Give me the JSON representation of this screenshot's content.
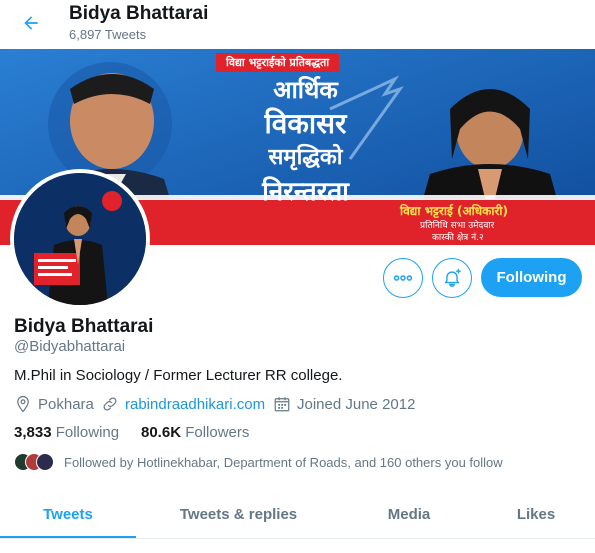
{
  "header": {
    "title": "Bidya Bhattarai",
    "tweet_count": "6,897 Tweets",
    "back_icon": "arrow-left-icon"
  },
  "banner": {
    "tag": "विद्या भट्टराईको प्रतिबद्धता",
    "title_line1": "आर्थिक",
    "title_line2": "विकासर",
    "title_line3": "समृद्धिको",
    "title_line4": "निरन्तरता",
    "candidate_name": "विद्या भट्टराई (अधिकारी)",
    "subtitle1": "प्रतिनिधि सभा उमेदवार",
    "subtitle2": "कास्की क्षेत्र नं.२",
    "colors": {
      "blue": "#1a5fb4",
      "red": "#e0222a",
      "yellow": "#ffe34d"
    }
  },
  "actions": {
    "more_icon": "more-icon",
    "notify_icon": "bell-plus-icon",
    "follow_label": "Following"
  },
  "profile": {
    "name": "Bidya Bhattarai",
    "handle": "@Bidyabhattarai",
    "bio": "M.Phil in Sociology / Former Lecturer RR college.",
    "location": "Pokhara",
    "website": "rabindraadhikari.com",
    "joined": "Joined June 2012",
    "following_count": "3,833",
    "following_label": "Following",
    "followers_count": "80.6K",
    "followers_label": "Followers",
    "followed_by": "Followed by Hotlinekhabar, Department of Roads, and 160 others you follow"
  },
  "tabs": [
    {
      "label": "Tweets",
      "active": true
    },
    {
      "label": "Tweets & replies",
      "active": false
    },
    {
      "label": "Media",
      "active": false
    },
    {
      "label": "Likes",
      "active": false
    }
  ],
  "theme": {
    "accent": "#1da1f2",
    "muted": "#657786",
    "text": "#14171a"
  }
}
